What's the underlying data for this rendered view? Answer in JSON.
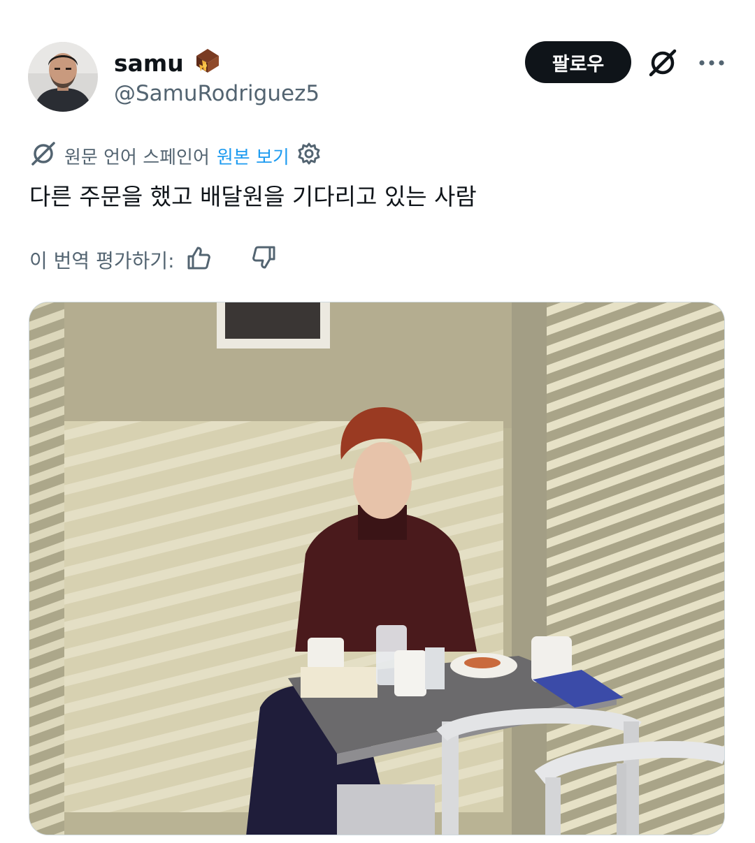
{
  "author": {
    "display_name": "samu",
    "handle": "@SamuRodriguez5",
    "badge_icon": "treasure-chest-emoji-icon"
  },
  "actions": {
    "follow_label": "팔로우",
    "grok_icon": "grok-icon",
    "more_icon": "more-horizontal-icon"
  },
  "translation": {
    "source_language_text": "원문 언어 스페인어",
    "show_original_label": "원본 보기",
    "settings_icon": "gear-icon"
  },
  "tweet": {
    "text": "다른 주문을 했고 배달원을 기다리고 있는 사람"
  },
  "rating": {
    "prompt": "이 번역 평가하기:",
    "thumbs_up_icon": "thumbs-up-icon",
    "thumbs_down_icon": "thumbs-down-icon"
  },
  "media": {
    "type": "photo",
    "subject": "woman-sitting-alone-at-restaurant-table"
  },
  "colors": {
    "text_primary": "#0f1419",
    "text_secondary": "#536471",
    "link_blue": "#1d9bf0",
    "follow_bg": "#0f1419"
  }
}
